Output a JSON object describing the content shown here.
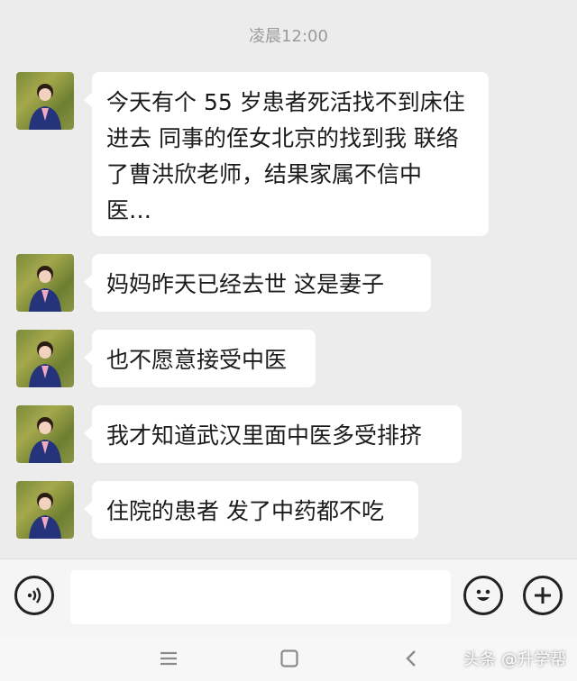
{
  "chat": {
    "timestamp": "凌晨12:00",
    "messages": [
      {
        "lines": [
          "今天有个 55 岁患者死活找不到床住",
          "进去 同事的侄女北京的找到我 联络",
          "了曹洪欣老师，结果家属不信中",
          "医…"
        ]
      },
      {
        "lines": [
          "妈妈昨天已经去世  这是妻子"
        ]
      },
      {
        "lines": [
          "也不愿意接受中医"
        ]
      },
      {
        "lines": [
          "我才知道武汉里面中医多受排挤"
        ]
      },
      {
        "lines": [
          "住院的患者 发了中药都不吃"
        ]
      }
    ]
  },
  "input_bar": {
    "voice_icon": "voice-input-icon",
    "emoji_icon": "emoji-icon",
    "plus_icon": "plus-icon",
    "text_value": ""
  },
  "nav_bar": {
    "menu_icon": "menu-icon",
    "home_icon": "home-square-icon",
    "back_icon": "back-chevron-icon"
  },
  "watermark": "头条 @升学帮",
  "colors": {
    "background": "#ececec",
    "bubble": "#ffffff",
    "timestamp": "#9a9a9a"
  }
}
